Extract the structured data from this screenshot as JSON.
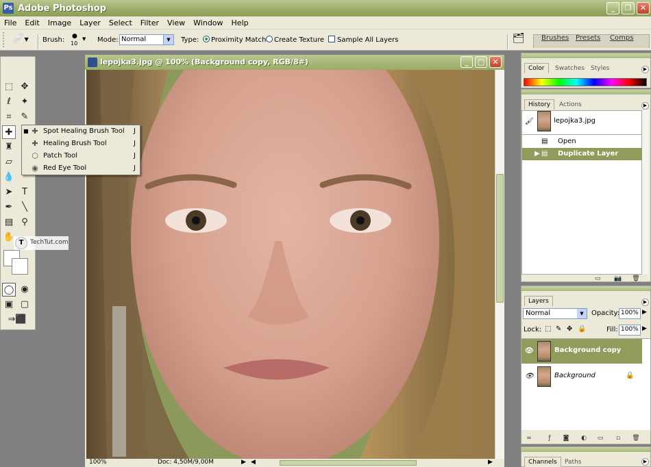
{
  "app": {
    "title": "Adobe Photoshop",
    "icon": "photoshop-icon",
    "window_buttons": [
      "_",
      "❐",
      "✕"
    ]
  },
  "menu": [
    "File",
    "Edit",
    "Image",
    "Layer",
    "Select",
    "Filter",
    "View",
    "Window",
    "Help"
  ],
  "options": {
    "brush_label": "Brush:",
    "brush_size": "10",
    "mode_label": "Mode:",
    "mode_value": "Normal",
    "type_label": "Type:",
    "type_options": [
      {
        "label": "Proximity Match",
        "selected": true
      },
      {
        "label": "Create Texture",
        "selected": false
      }
    ],
    "sample_all_layers": {
      "label": "Sample All Layers",
      "checked": false
    },
    "well_tabs": [
      "Brushes",
      "Presets",
      "Comps"
    ]
  },
  "document": {
    "title": "lepojka3.jpg @ 100% (Background copy, RGB/8#)",
    "zoom": "100%",
    "doc_size": "Doc: 4,50M/9,00M"
  },
  "tool_flyout": {
    "items": [
      {
        "label": "Spot Healing Brush Tool",
        "shortcut": "J",
        "icon": "spot-healing-brush-icon",
        "active": true
      },
      {
        "label": "Healing Brush Tool",
        "shortcut": "J",
        "icon": "healing-brush-icon",
        "active": false
      },
      {
        "label": "Patch Tool",
        "shortcut": "J",
        "icon": "patch-tool-icon",
        "active": false
      },
      {
        "label": "Red Eye Tool",
        "shortcut": "J",
        "icon": "red-eye-tool-icon",
        "active": false
      }
    ]
  },
  "watermark": {
    "logo": "T",
    "text": "TechTut.com"
  },
  "color_palette": {
    "tabs": [
      "Color",
      "Swatches",
      "Styles"
    ],
    "active": "Color"
  },
  "history_palette": {
    "tabs": [
      "History",
      "Actions"
    ],
    "active": "History",
    "snapshot": "lepojka3.jpg",
    "items": [
      {
        "label": "Open",
        "selected": false
      },
      {
        "label": "Duplicate Layer",
        "selected": true
      }
    ]
  },
  "layers_palette": {
    "tab": "Layers",
    "blend_mode": "Normal",
    "opacity_label": "Opacity:",
    "opacity": "100%",
    "lock_label": "Lock:",
    "fill_label": "Fill:",
    "fill": "100%",
    "layers": [
      {
        "name": "Background copy",
        "selected": true,
        "locked": false
      },
      {
        "name": "Background",
        "selected": false,
        "locked": true
      }
    ]
  },
  "channels_palette": {
    "tabs": [
      "Channels",
      "Paths"
    ],
    "active": "Channels"
  }
}
